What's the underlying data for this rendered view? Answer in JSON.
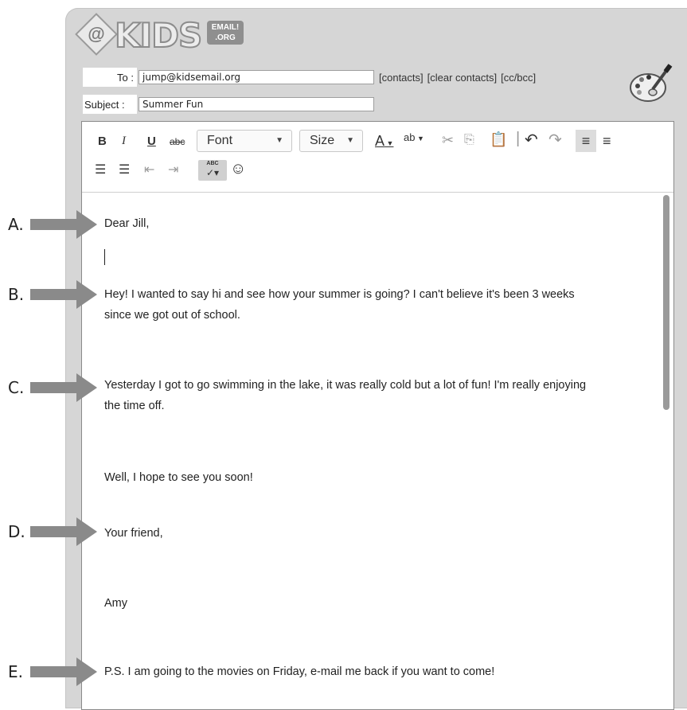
{
  "logo": {
    "mark": "@",
    "word": "KIDS",
    "badge_line1": "EMAIL!",
    "badge_line2": ".ORG"
  },
  "address": {
    "to_label": "To :",
    "to_value": "jump@kidsemail.org",
    "links": [
      "[contacts]",
      "[clear contacts]",
      "[cc/bcc]"
    ],
    "subject_label": "Subject :",
    "subject_value": "Summer Fun"
  },
  "toolbar": {
    "bold": "B",
    "italic": "I",
    "underline": "U",
    "strike": "abc",
    "font_select": "Font",
    "size_select": "Size",
    "text_color": "A",
    "bg_color": "ab",
    "spellcheck": "ABC"
  },
  "message": {
    "greeting": "Dear Jill,",
    "para1_line1": "Hey! I wanted to say hi and see how your summer is going? I can't believe it's been 3 weeks",
    "para1_line2": "since we got out of school.",
    "para2_line1": "Yesterday I got to go swimming in the lake, it was really cold but a lot of fun! I'm really enjoying",
    "para2_line2": "the time off.",
    "closing_line": "Well, I hope to see you soon!",
    "signoff": "Your friend,",
    "signature": "Amy",
    "ps": "P.S. I am going to the movies on Friday, e-mail me back if you want to come!"
  },
  "annotations": [
    "A.",
    "B.",
    "C.",
    "D.",
    "E."
  ],
  "colors": {
    "window_bg": "#d6d6d6",
    "arrow": "#8a8a8a",
    "editor_border": "#8a8a8a"
  }
}
